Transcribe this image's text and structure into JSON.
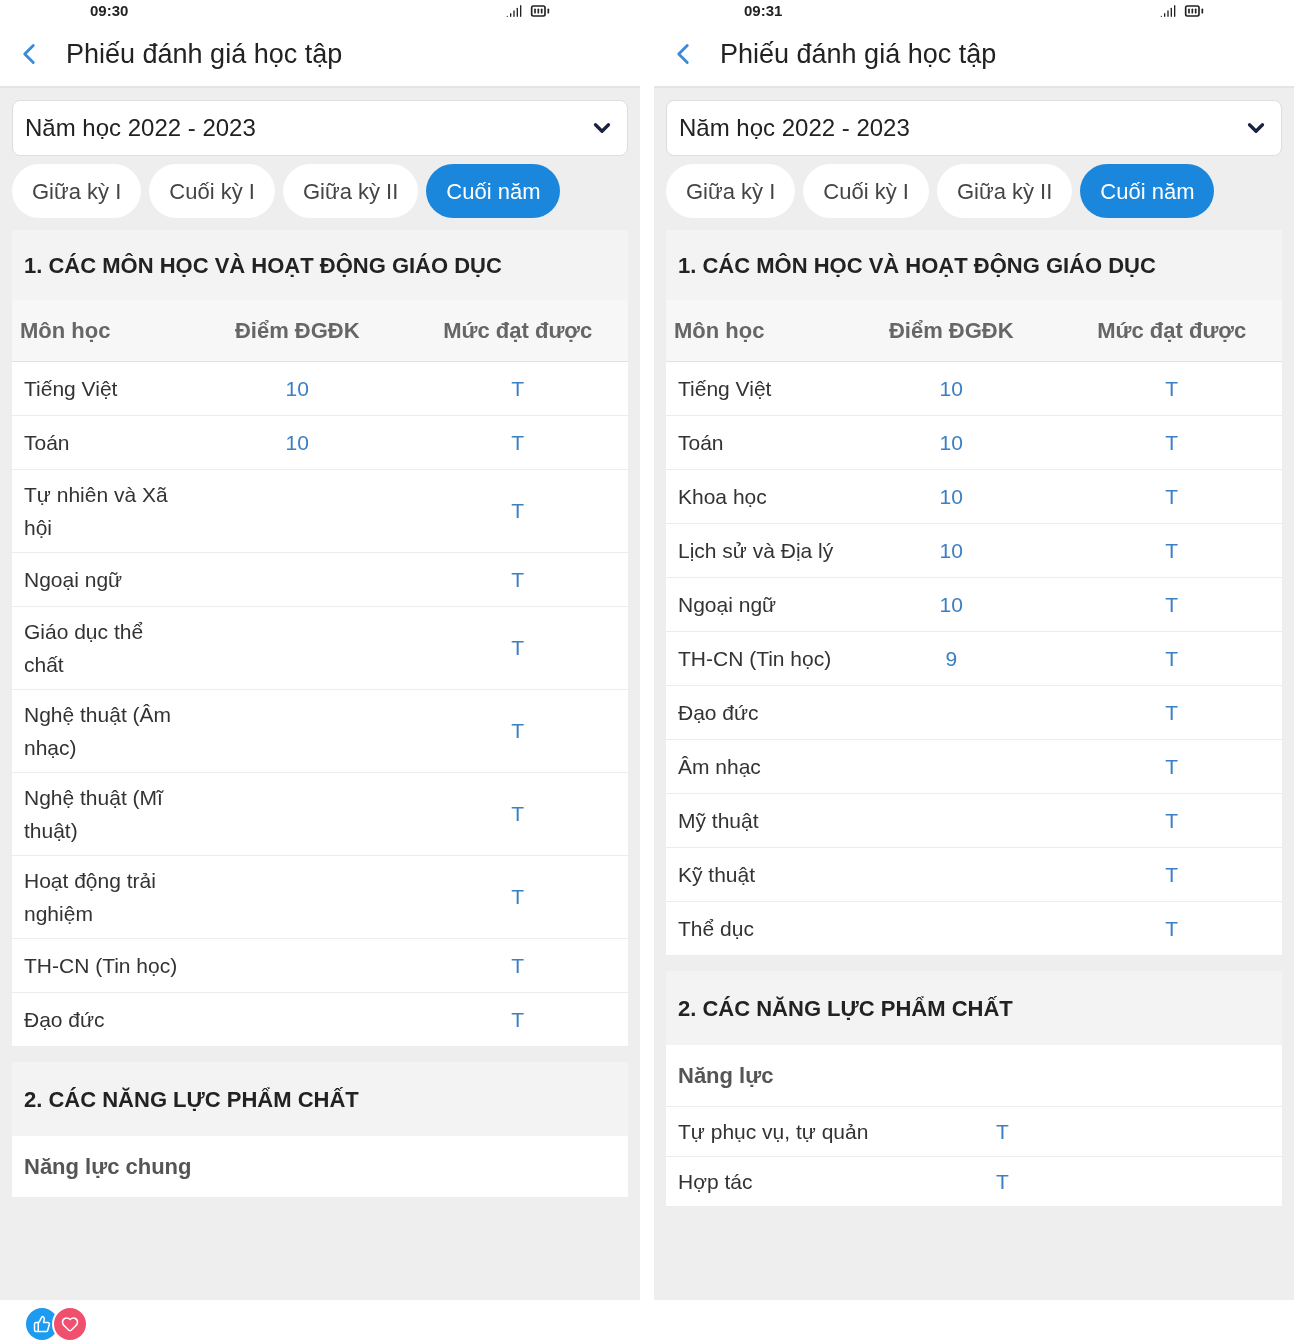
{
  "panels": [
    {
      "status_time": "09:30",
      "title": "Phiếu đánh giá học tập",
      "school_year": "Năm học 2022 - 2023",
      "tabs": [
        {
          "label": "Giữa kỳ I",
          "selected": false
        },
        {
          "label": "Cuối kỳ I",
          "selected": false
        },
        {
          "label": "Giữa kỳ II",
          "selected": false
        },
        {
          "label": "Cuối năm",
          "selected": true
        }
      ],
      "subjects_section": {
        "title": "1. CÁC MÔN HỌC VÀ HOẠT ĐỘNG GIÁO DỤC",
        "columns": [
          "Môn học",
          "Điểm ĐGĐK",
          "Mức đạt được"
        ],
        "rows": [
          {
            "subject": "Tiếng Việt",
            "score": "10",
            "grade": "T"
          },
          {
            "subject": "Toán",
            "score": "10",
            "grade": "T"
          },
          {
            "subject": "Tự nhiên và Xã hội",
            "grade": "T"
          },
          {
            "subject": "Ngoại ngữ",
            "grade": "T"
          },
          {
            "subject": "Giáo dục thể chất",
            "grade": "T"
          },
          {
            "subject": "Nghệ thuật (Âm nhạc)",
            "grade": "T"
          },
          {
            "subject": "Nghệ thuật (Mĩ thuật)",
            "grade": "T"
          },
          {
            "subject": "Hoạt động trải nghiệm",
            "grade": "T"
          },
          {
            "subject": "TH-CN (Tin học)",
            "grade": "T"
          },
          {
            "subject": "Đạo đức",
            "grade": "T"
          }
        ]
      },
      "competencies_section": {
        "title": "2. CÁC NĂNG LỰC PHẨM CHẤT",
        "subheading": "Năng lực chung"
      }
    },
    {
      "status_time": "09:31",
      "title": "Phiếu đánh giá học tập",
      "school_year": "Năm học 2022 - 2023",
      "tabs": [
        {
          "label": "Giữa kỳ I",
          "selected": false
        },
        {
          "label": "Cuối kỳ I",
          "selected": false
        },
        {
          "label": "Giữa kỳ II",
          "selected": false
        },
        {
          "label": "Cuối năm",
          "selected": true
        }
      ],
      "subjects_section": {
        "title": "1. CÁC MÔN HỌC VÀ HOẠT ĐỘNG GIÁO DỤC",
        "columns": [
          "Môn học",
          "Điểm ĐGĐK",
          "Mức đạt được"
        ],
        "rows": [
          {
            "subject": "Tiếng Việt",
            "score": "10",
            "grade": "T"
          },
          {
            "subject": "Toán",
            "score": "10",
            "grade": "T"
          },
          {
            "subject": "Khoa học",
            "score": "10",
            "grade": "T"
          },
          {
            "subject": "Lịch sử và Địa lý",
            "score": "10",
            "grade": "T"
          },
          {
            "subject": "Ngoại ngữ",
            "score": "10",
            "grade": "T"
          },
          {
            "subject": "TH-CN (Tin học)",
            "score": "9",
            "grade": "T"
          },
          {
            "subject": "Đạo đức",
            "grade": "T"
          },
          {
            "subject": "Âm nhạc",
            "grade": "T"
          },
          {
            "subject": "Mỹ thuật",
            "grade": "T"
          },
          {
            "subject": "Kỹ thuật",
            "grade": "T"
          },
          {
            "subject": "Thể dục",
            "grade": "T"
          }
        ]
      },
      "competencies_section": {
        "title": "2. CÁC NĂNG LỰC PHẨM CHẤT",
        "subheading": "Năng lực",
        "rows": [
          {
            "name": "Tự phục vụ, tự quản",
            "grade": "T"
          },
          {
            "name": "Hợp tác",
            "grade": "T"
          }
        ]
      }
    }
  ]
}
